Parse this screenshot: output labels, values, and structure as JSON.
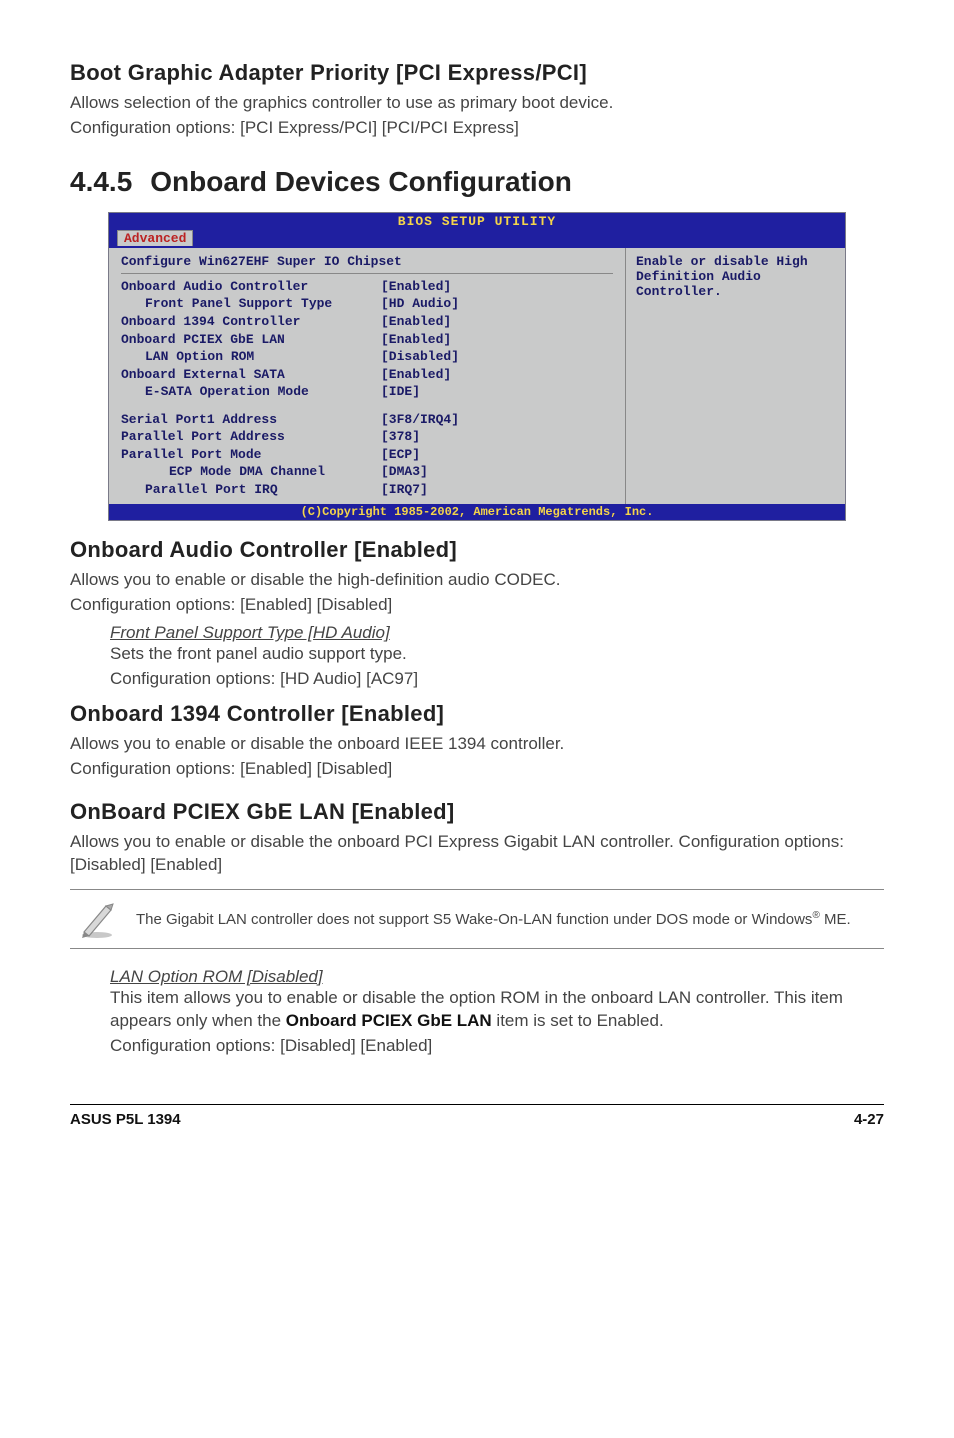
{
  "sections": {
    "boot_graphic": {
      "title": "Boot Graphic Adapter Priority [PCI Express/PCI]",
      "desc1": "Allows selection of the graphics controller to use as primary boot device.",
      "desc2": "Configuration options: [PCI Express/PCI] [PCI/PCI Express]"
    },
    "numbered": {
      "num": "4.4.5",
      "title": "Onboard Devices Configuration"
    },
    "audio": {
      "title": "Onboard Audio Controller [Enabled]",
      "desc1": "Allows you to enable or disable the high-definition audio CODEC.",
      "desc2": "Configuration options: [Enabled] [Disabled]",
      "sub_title": "Front Panel Support Type [HD Audio]",
      "sub_desc1": "Sets the front panel audio support type.",
      "sub_desc2": "Configuration options: [HD Audio] [AC97]"
    },
    "c1394": {
      "title": "Onboard 1394 Controller [Enabled]",
      "desc1": "Allows you to enable or disable the onboard IEEE 1394 controller.",
      "desc2": "Configuration options: [Enabled] [Disabled]"
    },
    "pciex": {
      "title": "OnBoard PCIEX GbE LAN [Enabled]",
      "desc1": "Allows you to enable or disable the onboard PCI Express Gigabit LAN controller. Configuration options: [Disabled] [Enabled]"
    },
    "note": {
      "text1": "The Gigabit LAN controller does not support S5 Wake-On-LAN function under DOS mode or Windows",
      "text2": " ME."
    },
    "lan_rom": {
      "title": "LAN Option ROM [Disabled]",
      "desc1": "This item allows you to enable or disable the option ROM in the onboard LAN controller. This item appears only when the ",
      "bold": "Onboard PCIEX GbE LAN",
      "desc2": " item is set to Enabled.",
      "desc3": "Configuration options: [Disabled] [Enabled]"
    }
  },
  "bios": {
    "title": "BIOS SETUP UTILITY",
    "tab": "Advanced",
    "subhead": "Configure Win627EHF Super IO Chipset",
    "rows": [
      {
        "label": "Onboard Audio Controller",
        "value": "[Enabled]",
        "indent": 0
      },
      {
        "label": "Front Panel Support Type",
        "value": "[HD Audio]",
        "indent": 1
      },
      {
        "label": "Onboard 1394 Controller",
        "value": "[Enabled]",
        "indent": 0
      },
      {
        "label": "Onboard PCIEX GbE LAN",
        "value": "[Enabled]",
        "indent": 0
      },
      {
        "label": "LAN Option ROM",
        "value": "[Disabled]",
        "indent": 1
      },
      {
        "label": "Onboard External SATA",
        "value": "[Enabled]",
        "indent": 0
      },
      {
        "label": "E-SATA Operation Mode",
        "value": "[IDE]",
        "indent": 1
      }
    ],
    "rows2": [
      {
        "label": "Serial Port1 Address",
        "value": "[3F8/IRQ4]",
        "indent": 0
      },
      {
        "label": "Parallel Port Address",
        "value": "[378]",
        "indent": 0
      },
      {
        "label": "Parallel Port Mode",
        "value": "[ECP]",
        "indent": 0
      },
      {
        "label": "ECP Mode DMA Channel",
        "value": "[DMA3]",
        "indent": 2
      },
      {
        "label": "Parallel Port IRQ",
        "value": "[IRQ7]",
        "indent": 1
      }
    ],
    "help": "Enable or disable High Definition Audio Controller.",
    "footer": "(C)Copyright 1985-2002, American Megatrends, Inc."
  },
  "footer": {
    "left": "ASUS P5L 1394",
    "right": "4-27"
  }
}
